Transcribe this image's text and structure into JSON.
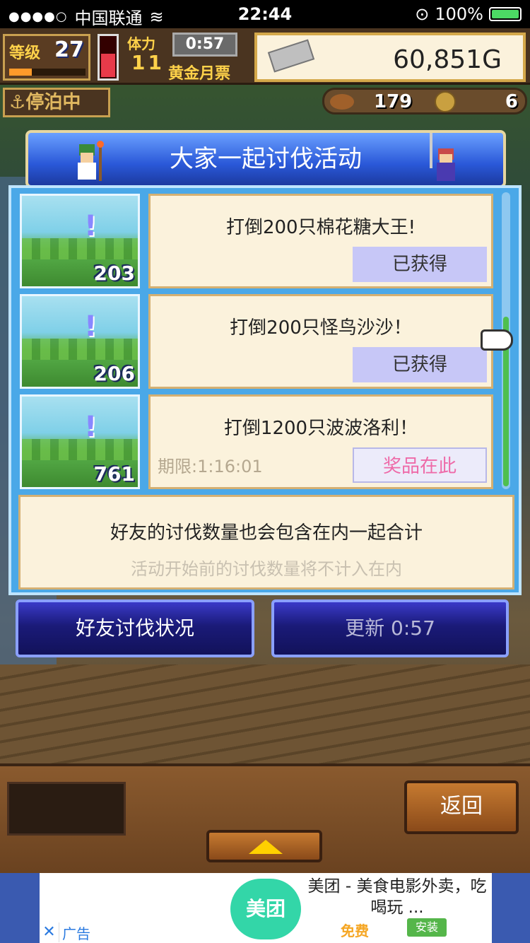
{
  "status_bar": {
    "signal": "●●●●○",
    "carrier": "中国联通",
    "time": "22:44",
    "battery_percent": "100%"
  },
  "hud": {
    "level_label": "等级",
    "level": "27",
    "stamina_label": "体力",
    "stamina": "11",
    "timer": "0:57",
    "ticket_label": "黄金月票",
    "gold": "60,851G",
    "status_label": "停泊中",
    "food_count": "179",
    "medal_count": "6"
  },
  "dialog": {
    "title": "大家一起讨伐活动",
    "quests": [
      {
        "title": "打倒200只棉花糖大王!",
        "count": "203",
        "status": "已获得",
        "deadline": ""
      },
      {
        "title": "打倒200只怪鸟沙沙！",
        "count": "206",
        "status": "已获得",
        "deadline": ""
      },
      {
        "title": "打倒1200只波波洛利！",
        "count": "761",
        "status": "奖品在此",
        "deadline": "期限:1:16:01"
      }
    ],
    "notice_main": "好友的讨伐数量也会包含在内一起合计",
    "notice_sub": "活动开始前的讨伐数量将不计入在内"
  },
  "buttons": {
    "friends_status": "好友讨伐状况",
    "refresh": "更新 0:57",
    "back": "返回"
  },
  "ad": {
    "logo_text": "美团",
    "title": "美团 - 美食电影外卖，吃喝玩 ...",
    "free": "免费",
    "install": "安装",
    "label": "广告",
    "close": "✕"
  },
  "colors": {
    "dialog_bg": "#4aa8e8",
    "card_bg": "#fbf2dc",
    "claimed_bg": "#c7c7f7",
    "prize_text": "#ee6aa8",
    "button_bg": "#1a1a78"
  }
}
